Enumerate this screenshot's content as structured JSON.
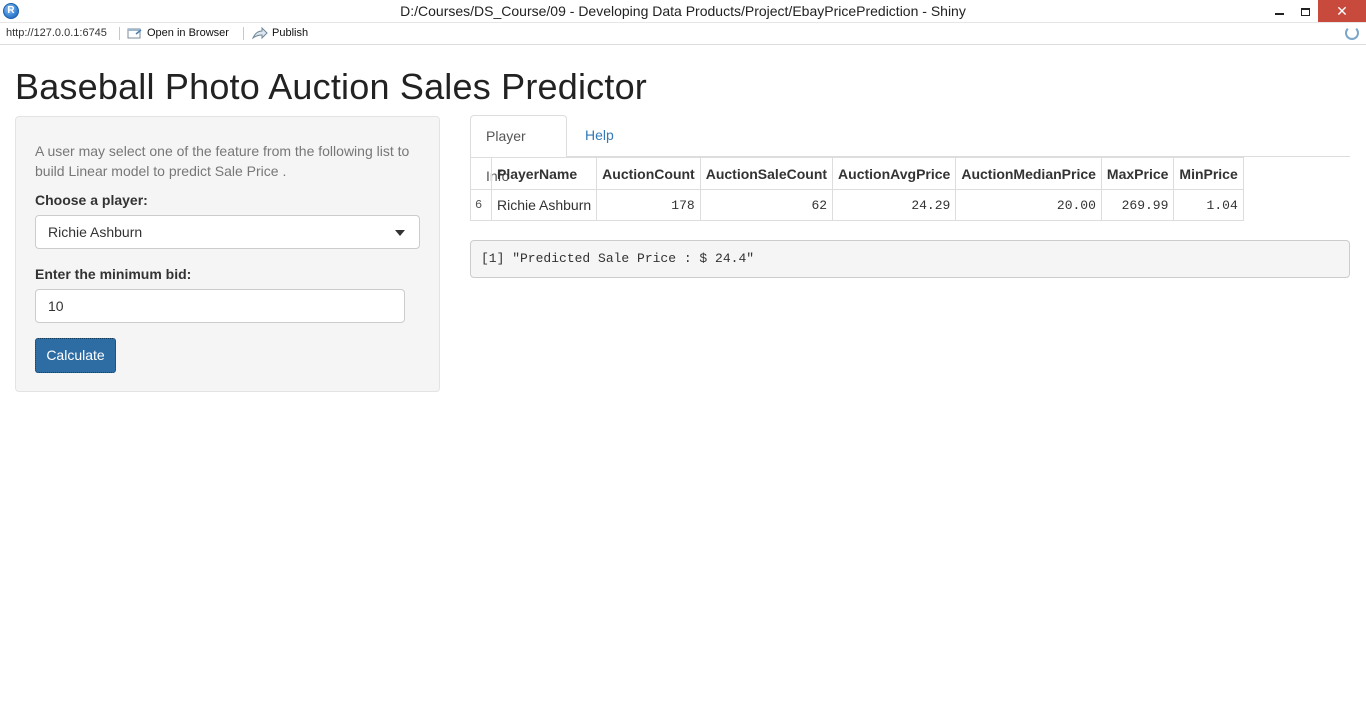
{
  "window": {
    "title": "D:/Courses/DS_Course/09 - Developing Data Products/Project/EbayPricePrediction - Shiny",
    "app_icon_letter": "R",
    "close_glyph": "✕"
  },
  "toolbar": {
    "url": "http://127.0.0.1:6745",
    "open_in_browser": "Open in Browser",
    "publish": "Publish"
  },
  "page": {
    "title": "Baseball Photo Auction Sales Predictor"
  },
  "sidebar": {
    "intro": "A user may select one of the feature from the following list to build Linear model to predict Sale Price .",
    "player_label": "Choose a player:",
    "player_selected": "Richie Ashburn",
    "bid_label": "Enter the minimum bid:",
    "bid_value": "10",
    "calculate_label": "Calculate"
  },
  "tabs": [
    {
      "label": "Player Info",
      "active": true
    },
    {
      "label": "Help",
      "active": false
    }
  ],
  "table": {
    "headers": [
      "",
      "PlayerName",
      "AuctionCount",
      "AuctionSaleCount",
      "AuctionAvgPrice",
      "AuctionMedianPrice",
      "MaxPrice",
      "MinPrice"
    ],
    "rows": [
      [
        "6",
        "Richie Ashburn",
        "178",
        "62",
        "24.29",
        "20.00",
        "269.99",
        "1.04"
      ]
    ]
  },
  "output": {
    "prediction_text": "[1] \"Predicted Sale Price : $ 24.4\""
  },
  "colors": {
    "accent": "#337ab7",
    "button": "#2e6da4",
    "close_button": "#c74a3d"
  },
  "icons": [
    "app-r-icon",
    "open-in-browser-icon",
    "publish-icon",
    "refresh-icon",
    "dropdown-caret-icon"
  ]
}
